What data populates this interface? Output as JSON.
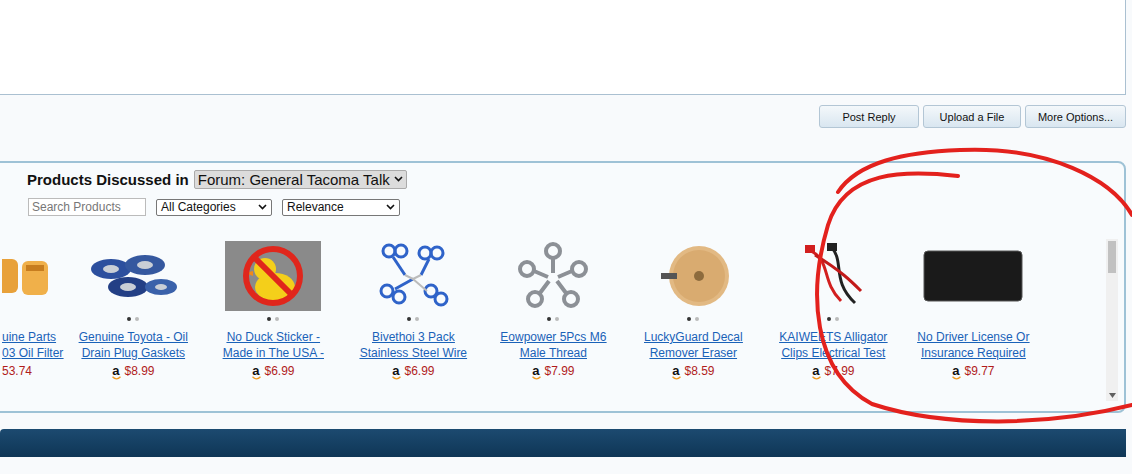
{
  "toolbar": {
    "buttons": [
      "Post Reply",
      "Upload a File",
      "More Options..."
    ]
  },
  "products_panel": {
    "title": "Products Discussed in",
    "scope": "Forum: General Tacoma Talk",
    "search": {
      "placeholder": "Search Products"
    },
    "category": "All Categories",
    "sort": "Relevance",
    "store_icon": "a",
    "items": [
      {
        "kind": "clipped",
        "title_lines": [
          "uine Parts",
          "03 Oil Filter"
        ],
        "price": "53.74",
        "photos": 0,
        "current": 0
      },
      {
        "kind": "full",
        "title_lines": [
          "Genuine Toyota - Oil",
          "Drain Plug Gaskets"
        ],
        "price": "$8.99",
        "photos": 2,
        "current": 0
      },
      {
        "kind": "full",
        "title_lines": [
          "No Duck Sticker -",
          "Made in The USA -"
        ],
        "price": "$6.99",
        "photos": 2,
        "current": 0
      },
      {
        "kind": "full",
        "title_lines": [
          "Bivethoi 3 Pack",
          "Stainless Steel Wire"
        ],
        "price": "$6.99",
        "photos": 2,
        "current": 0
      },
      {
        "kind": "full",
        "title_lines": [
          "Eowpower 5Pcs M6",
          "Male Thread"
        ],
        "price": "$7.99",
        "photos": 2,
        "current": 0
      },
      {
        "kind": "full",
        "title_lines": [
          "LuckyGuard Decal",
          "Remover Eraser"
        ],
        "price": "$8.59",
        "photos": 2,
        "current": 0
      },
      {
        "kind": "full",
        "title_lines": [
          "KAIWEETS Alligator",
          "Clips Electrical Test"
        ],
        "price": "$7.99",
        "photos": 2,
        "current": 0
      },
      {
        "kind": "full",
        "title_lines": [
          "No Driver License Or",
          "Insurance Required"
        ],
        "price": "$9.77",
        "photos": 0,
        "current": 0
      }
    ]
  }
}
